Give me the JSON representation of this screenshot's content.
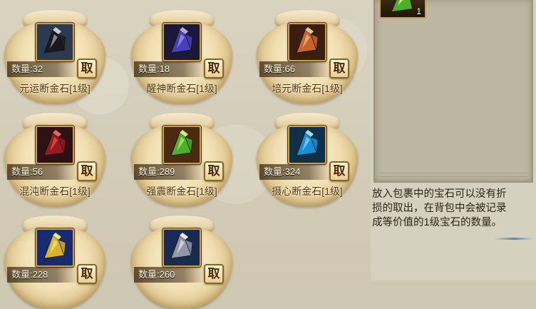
{
  "bags": [
    {
      "name": "元运断金石[1级]",
      "count_text": "数量:32",
      "take_label": "取",
      "gem_color": "#1a1a1e",
      "gem_highlight": "#d8dde6",
      "bg": "#2b3a4e"
    },
    {
      "name": "醒神断金石[1级]",
      "count_text": "数量:18",
      "take_label": "取",
      "gem_color": "#4a3fb8",
      "gem_highlight": "#c8b8ff",
      "bg": "#1c1838"
    },
    {
      "name": "培元断金石[1级]",
      "count_text": "数量:66",
      "take_label": "取",
      "gem_color": "#c8632a",
      "gem_highlight": "#ffd4a0",
      "bg": "#3a1e12"
    },
    {
      "name": "混沌断金石[1级]",
      "count_text": "数量:56",
      "take_label": "取",
      "gem_color": "#9a1820",
      "gem_highlight": "#ff6b6b",
      "bg": "#2c1214"
    },
    {
      "name": "强震断金石[1级]",
      "count_text": "数量:289",
      "take_label": "取",
      "gem_color": "#4fae2a",
      "gem_highlight": "#d8ff9a",
      "bg": "#4a2a10"
    },
    {
      "name": "摄心断金石[1级]",
      "count_text": "数量:324",
      "take_label": "取",
      "gem_color": "#1b8ed8",
      "gem_highlight": "#a8f0ff",
      "bg": "#10304a"
    },
    {
      "name": "",
      "count_text": "数量:228",
      "take_label": "取",
      "gem_color": "#d7b52c",
      "gem_highlight": "#fff5a8",
      "bg": "#1a2a70"
    },
    {
      "name": "",
      "count_text": "数量:260",
      "take_label": "取",
      "gem_color": "#8f98a8",
      "gem_highlight": "#ffffff",
      "bg": "#1a2a50"
    }
  ],
  "side": {
    "slot_count": "1",
    "slot_gem_color": "#4fae2a",
    "slot_gem_highlight": "#d8ff9a",
    "hint_lines": [
      "放入包裹中的宝石可以没有折",
      "损的取出，在背包中会被记录",
      "成等价值的1级宝石的数量。"
    ]
  }
}
